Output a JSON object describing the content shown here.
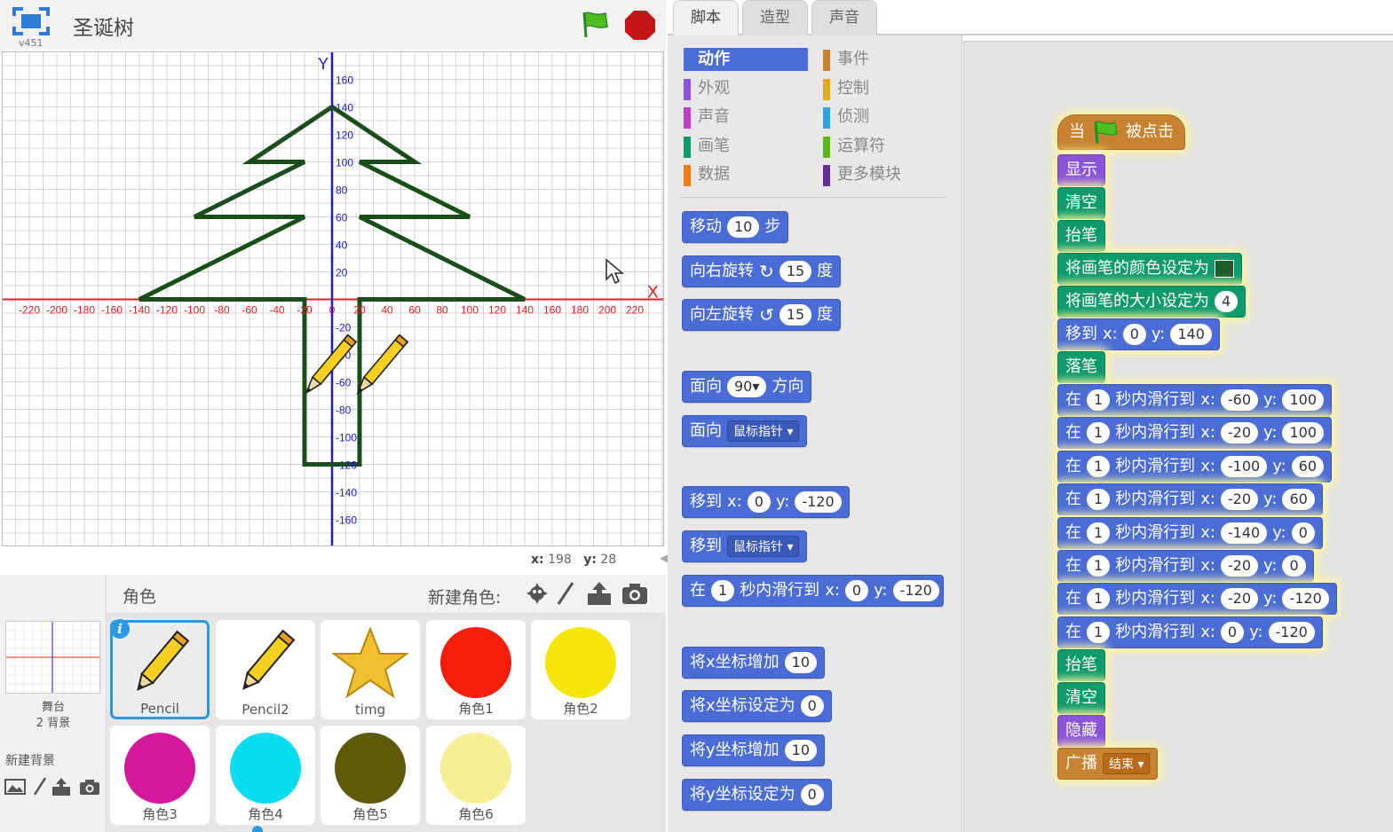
{
  "project": {
    "title": "圣诞树",
    "version": "v451"
  },
  "mouse": {
    "x_label": "x:",
    "x_value": "198",
    "y_label": "y:",
    "y_value": "28"
  },
  "stage": {
    "x_axis_label": "X",
    "y_axis_label": "Y",
    "x_ticks": [
      "-220",
      "-200",
      "-180",
      "-160",
      "-140",
      "-120",
      "-100",
      "-80",
      "-60",
      "-40",
      "-20",
      "0",
      "20",
      "40",
      "60",
      "80",
      "100",
      "120",
      "140",
      "160",
      "180",
      "200",
      "220"
    ],
    "y_ticks": [
      "160",
      "140",
      "120",
      "100",
      "80",
      "60",
      "40",
      "20",
      "-20",
      "-40",
      "-60",
      "-80",
      "-100",
      "-120",
      "-140",
      "-160"
    ],
    "colors": {
      "grid": "#c8c8c8",
      "x_axis": "#e02020",
      "y_axis": "#1a1ad8",
      "tree": "#1a4d1a"
    }
  },
  "tabs": [
    {
      "label": "脚本"
    },
    {
      "label": "造型"
    },
    {
      "label": "声音"
    }
  ],
  "categories": [
    {
      "label": "动作",
      "color": "#4a6cd4"
    },
    {
      "label": "外观",
      "color": "#8a55d7"
    },
    {
      "label": "声音",
      "color": "#bb42c3"
    },
    {
      "label": "画笔",
      "color": "#0e9a6c"
    },
    {
      "label": "数据",
      "color": "#ee7d16"
    },
    {
      "label": "事件",
      "color": "#c88330"
    },
    {
      "label": "控制",
      "color": "#e1a91a"
    },
    {
      "label": "侦测",
      "color": "#2ca5e2"
    },
    {
      "label": "运算符",
      "color": "#5cb712"
    },
    {
      "label": "更多模块",
      "color": "#632d99"
    }
  ],
  "palette": {
    "move": {
      "label": "移动",
      "steps": "10",
      "unit": "步"
    },
    "turn_right": {
      "label": "向右旋转",
      "deg": "15",
      "unit": "度"
    },
    "turn_left": {
      "label": "向左旋转",
      "deg": "15",
      "unit": "度"
    },
    "point_dir": {
      "label": "面向",
      "value": "90▾",
      "suffix": "方向"
    },
    "point_towards": {
      "label": "面向",
      "value": "鼠标指针"
    },
    "goto_xy": {
      "label": "移到",
      "x_label": "x:",
      "x": "0",
      "y_label": "y:",
      "y": "-120"
    },
    "goto": {
      "label": "移到",
      "value": "鼠标指针"
    },
    "glide": {
      "prefix": "在",
      "secs": "1",
      "mid": "秒内滑行到",
      "x_label": "x:",
      "x": "0",
      "y_label": "y:",
      "y": "-120"
    },
    "change_x": {
      "label": "将x坐标增加",
      "value": "10"
    },
    "set_x": {
      "label": "将x坐标设定为",
      "value": "0"
    },
    "change_y": {
      "label": "将y坐标增加",
      "value": "10"
    },
    "set_y": {
      "label": "将y坐标设定为",
      "value": "0"
    }
  },
  "script": {
    "hat": {
      "prefix": "当",
      "suffix": "被点击"
    },
    "show": "显示",
    "clear1": "清空",
    "penup1": "抬笔",
    "set_color": "将画笔的颜色设定为",
    "set_size": {
      "label": "将画笔的大小设定为",
      "value": "4"
    },
    "goto": {
      "label": "移到",
      "x_label": "x:",
      "x": "0",
      "y_label": "y:",
      "y": "140"
    },
    "pendown": "落笔",
    "glide_prefix": "在",
    "glide_mid": "秒内滑行到",
    "glide_x_label": "x:",
    "glide_y_label": "y:",
    "glides": [
      {
        "secs": "1",
        "x": "-60",
        "y": "100"
      },
      {
        "secs": "1",
        "x": "-20",
        "y": "100"
      },
      {
        "secs": "1",
        "x": "-100",
        "y": "60"
      },
      {
        "secs": "1",
        "x": "-20",
        "y": "60"
      },
      {
        "secs": "1",
        "x": "-140",
        "y": "0"
      },
      {
        "secs": "1",
        "x": "-20",
        "y": "0"
      },
      {
        "secs": "1",
        "x": "-20",
        "y": "-120"
      },
      {
        "secs": "1",
        "x": "0",
        "y": "-120"
      }
    ],
    "penup2": "抬笔",
    "clear2": "清空",
    "hide": "隐藏",
    "broadcast": {
      "label": "广播",
      "value": "结束"
    }
  },
  "sprites_panel": {
    "title": "角色",
    "new_sprite_label": "新建角色:",
    "stage_label": "舞台",
    "stage_backdrops": "2 背景",
    "new_backdrop_label": "新建背景"
  },
  "sprites": [
    {
      "name": "Pencil",
      "kind": "pencil"
    },
    {
      "name": "Pencil2",
      "kind": "pencil"
    },
    {
      "name": "timg",
      "kind": "star",
      "color": "#f0c030"
    },
    {
      "name": "角色1",
      "kind": "circle",
      "color": "#f41e0a"
    },
    {
      "name": "角色2",
      "kind": "circle",
      "color": "#f5e60a"
    },
    {
      "name": "角色3",
      "kind": "circle",
      "color": "#d4189e"
    },
    {
      "name": "角色4",
      "kind": "circle",
      "color": "#0adcf0"
    },
    {
      "name": "角色5",
      "kind": "circle",
      "color": "#5e5a0a"
    },
    {
      "name": "角色6",
      "kind": "circle",
      "color": "#f5f096"
    }
  ]
}
